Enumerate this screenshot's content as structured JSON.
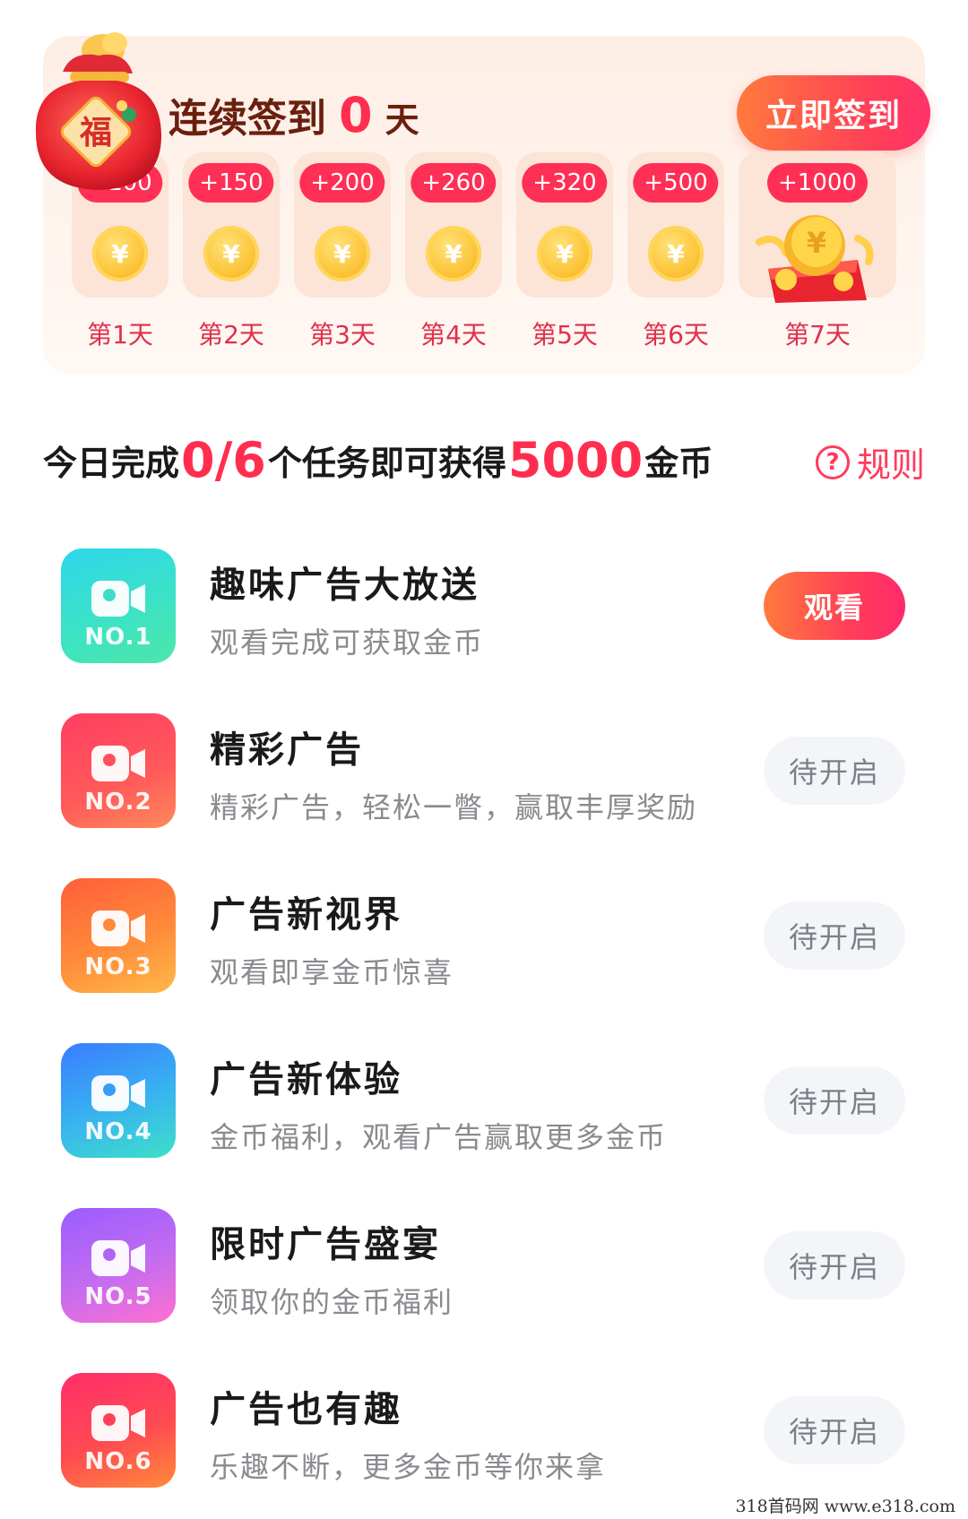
{
  "signin": {
    "title_prefix": "连续签到",
    "streak_days": "0",
    "title_suffix": "天",
    "button_label": "立即签到",
    "days": [
      {
        "reward": "+100",
        "label": "第1天"
      },
      {
        "reward": "+150",
        "label": "第2天"
      },
      {
        "reward": "+200",
        "label": "第3天"
      },
      {
        "reward": "+260",
        "label": "第4天"
      },
      {
        "reward": "+320",
        "label": "第5天"
      },
      {
        "reward": "+500",
        "label": "第6天"
      },
      {
        "reward": "+1000",
        "label": "第7天"
      }
    ],
    "coin_glyph": "¥",
    "bag_glyph": "福"
  },
  "tasks_header": {
    "prefix": "今日完成",
    "progress": "0/6",
    "middle": "个任务即可获得",
    "amount": "5000",
    "suffix": "金币",
    "rules_label": "规则",
    "rules_icon": "question-circle-icon"
  },
  "tasks": [
    {
      "no": "NO.1",
      "title": "趣味广告大放送",
      "desc": "观看完成可获取金币",
      "button": "观看",
      "state": "active"
    },
    {
      "no": "NO.2",
      "title": "精彩广告",
      "desc": "精彩广告，轻松一瞥，赢取丰厚奖励",
      "button": "待开启",
      "state": "pending"
    },
    {
      "no": "NO.3",
      "title": "广告新视界",
      "desc": "观看即享金币惊喜",
      "button": "待开启",
      "state": "pending"
    },
    {
      "no": "NO.4",
      "title": "广告新体验",
      "desc": "金币福利，观看广告赢取更多金币",
      "button": "待开启",
      "state": "pending"
    },
    {
      "no": "NO.5",
      "title": "限时广告盛宴",
      "desc": "领取你的金币福利",
      "button": "待开启",
      "state": "pending"
    },
    {
      "no": "NO.6",
      "title": "广告也有趣",
      "desc": "乐趣不断，更多金币等你来拿",
      "button": "待开启",
      "state": "pending"
    }
  ],
  "watermark": "318首码网  www.e318.com",
  "colors": {
    "accent": "#ff2e4f",
    "icon_gradients": [
      "#2fd3e6-#44e6b0",
      "#ff4a6a-#ff7b5a",
      "#ff6a3a-#ffb347",
      "#3a8cff-#3ee0d0",
      "#a25cff-#ff6fd8",
      "#ff3a6a-#ff8a3a"
    ]
  }
}
